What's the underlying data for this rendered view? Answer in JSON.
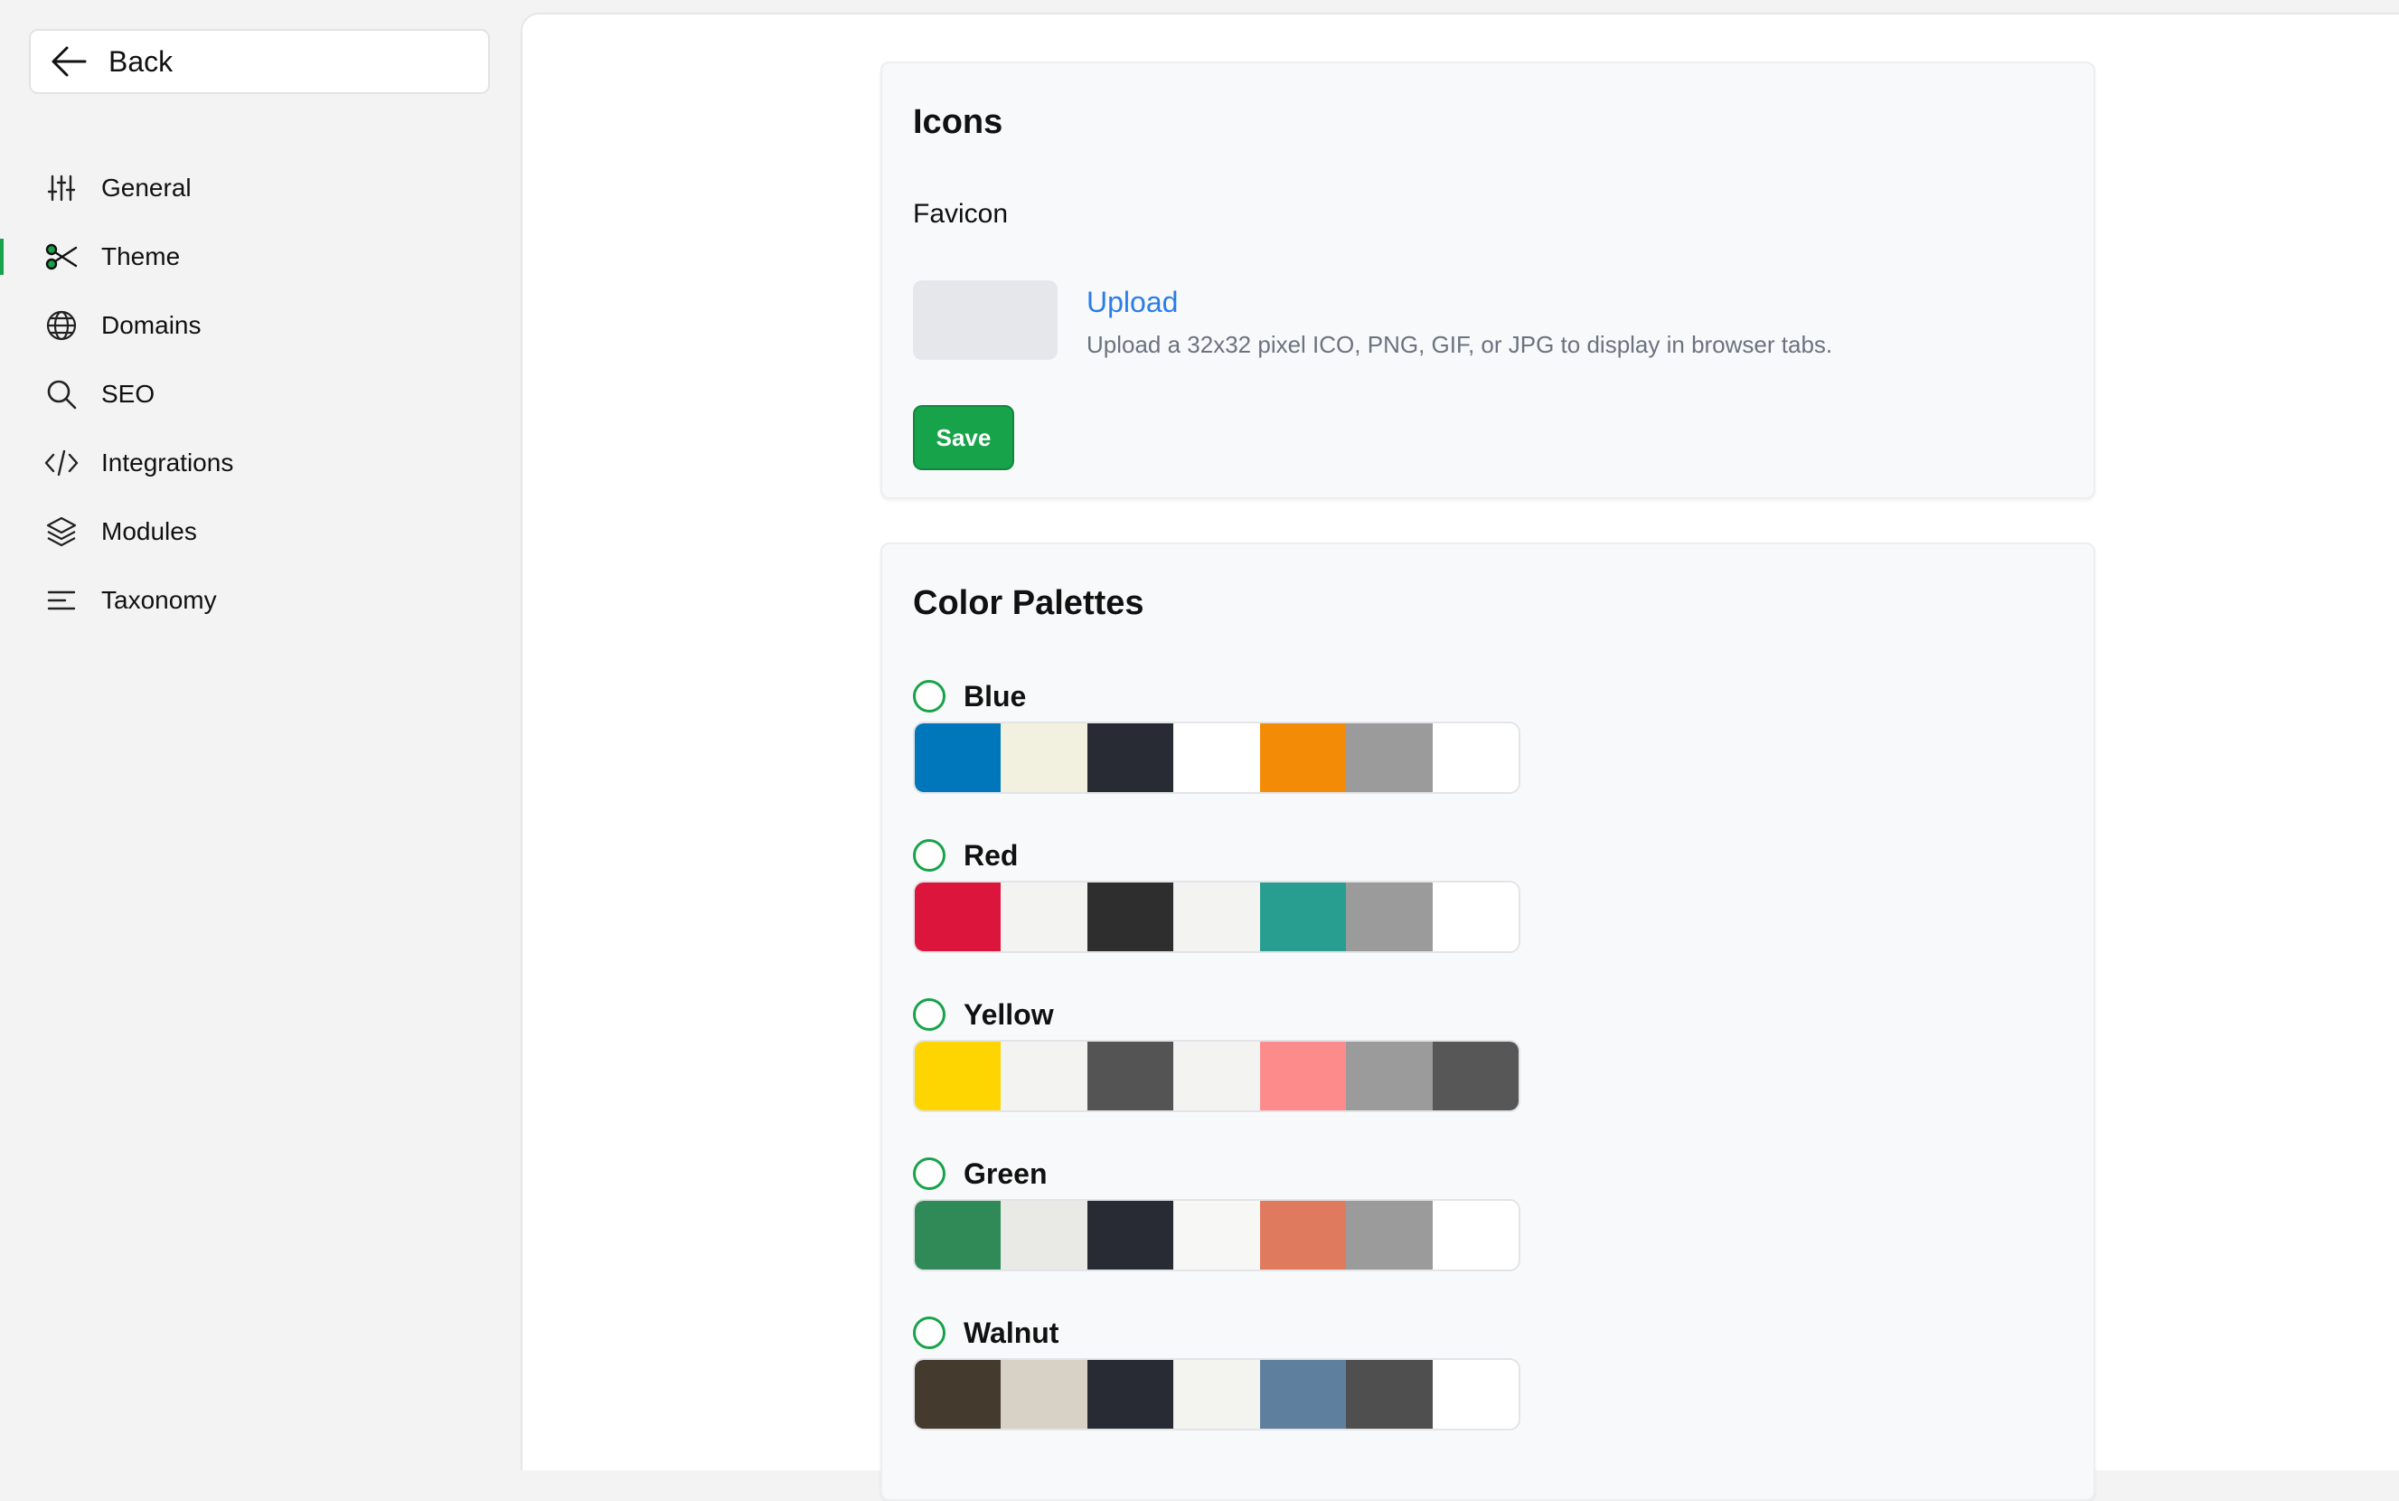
{
  "sidebar": {
    "back_label": "Back",
    "items": [
      {
        "label": "General",
        "icon": "sliders-icon"
      },
      {
        "label": "Theme",
        "icon": "scissors-icon",
        "active": true
      },
      {
        "label": "Domains",
        "icon": "globe-icon"
      },
      {
        "label": "SEO",
        "icon": "search-icon"
      },
      {
        "label": "Integrations",
        "icon": "code-icon"
      },
      {
        "label": "Modules",
        "icon": "layers-icon"
      },
      {
        "label": "Taxonomy",
        "icon": "menu-lines-icon"
      }
    ]
  },
  "icons_section": {
    "title": "Icons",
    "favicon_label": "Favicon",
    "upload_label": "Upload",
    "upload_help": "Upload a 32x32 pixel ICO, PNG, GIF, or JPG to display in browser tabs.",
    "save_label": "Save"
  },
  "colors_section": {
    "title": "Color Palettes",
    "palettes": [
      {
        "name": "Blue",
        "colors": [
          "#0077bb",
          "#f2f0df",
          "#292b34",
          "#ffffff",
          "#f48b07",
          "#9b9b9b",
          "#ffffff"
        ]
      },
      {
        "name": "Red",
        "colors": [
          "#dc153c",
          "#f3f3f2",
          "#2e2e2e",
          "#f3f3f2",
          "#279e90",
          "#9b9b9b",
          "#ffffff"
        ]
      },
      {
        "name": "Yellow",
        "colors": [
          "#fed501",
          "#f3f3f2",
          "#545454",
          "#f3f3f2",
          "#fd8b8b",
          "#9b9b9b",
          "#575757"
        ]
      },
      {
        "name": "Green",
        "colors": [
          "#2f8a57",
          "#e9e9e6",
          "#292b34",
          "#f7f7f6",
          "#e07a5f",
          "#9b9b9b",
          "#ffffff"
        ]
      },
      {
        "name": "Walnut",
        "colors": [
          "#453a2e",
          "#d8d1c6",
          "#292b34",
          "#f3f3f0",
          "#5f7f9e",
          "#4f4f4f",
          "#ffffff"
        ]
      }
    ]
  }
}
